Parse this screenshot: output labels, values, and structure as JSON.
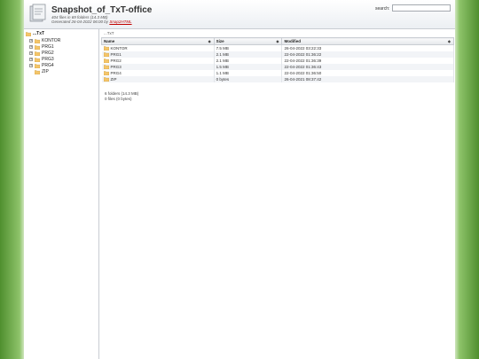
{
  "header": {
    "title": "Snapshot_of_TxT-office",
    "subtitle": "404 files in 69 folders (14.3 MB)",
    "generated_text": "Generated 26-04-2022 06:00 by",
    "generated_link": "Snap2HTML",
    "search_label": "search:",
    "search_value": ""
  },
  "tree": {
    "root": "...TxT",
    "items": [
      {
        "label": "KONTOR",
        "expander": "+"
      },
      {
        "label": "PRG1",
        "expander": "+"
      },
      {
        "label": "PRG2",
        "expander": "+"
      },
      {
        "label": "PRG3",
        "expander": "+"
      },
      {
        "label": "PRG4",
        "expander": "+"
      },
      {
        "label": "ZIP",
        "expander": ""
      }
    ]
  },
  "main": {
    "path": "...TxT",
    "columns": [
      "Name",
      "Size",
      "Modified"
    ],
    "sort_icon": "◆",
    "rows": [
      {
        "name": "KONTOR",
        "size": "7.5 MB",
        "modified": "26-04-2022 03:22:33"
      },
      {
        "name": "PRG1",
        "size": "2.1 MB",
        "modified": "22-04-2022 01:36:22"
      },
      {
        "name": "PRG2",
        "size": "2.1 MB",
        "modified": "22-04-2022 01:36:39"
      },
      {
        "name": "PRG3",
        "size": "1.5 MB",
        "modified": "22-04-2022 01:36:43"
      },
      {
        "name": "PRG4",
        "size": "1.1 MB",
        "modified": "22-04-2022 01:36:50"
      },
      {
        "name": "ZIP",
        "size": "0 bytes",
        "modified": "26-04-2021 08:37:42"
      }
    ],
    "summary_folders": "6 folders (14.3 MB)",
    "summary_files": "0 files (0 bytes)"
  },
  "colors": {
    "folder": "#f4c56a",
    "background_green": "#4f8f2e"
  }
}
